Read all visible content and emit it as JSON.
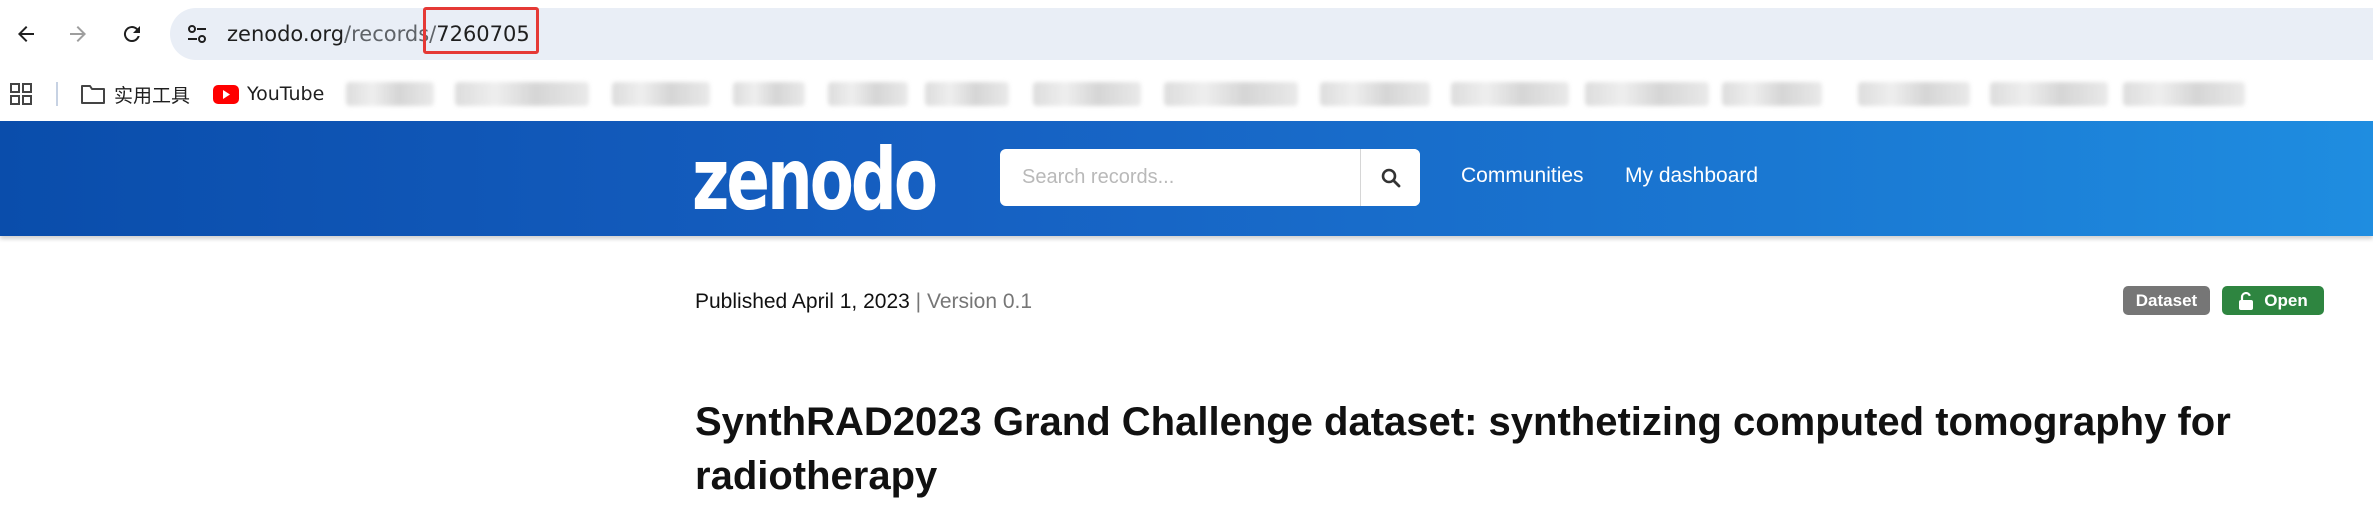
{
  "browser": {
    "url_host": "zenodo.org",
    "url_path": "/records/",
    "url_id": "7260705",
    "icons": {
      "back": "arrow-left-icon",
      "forward": "arrow-right-icon",
      "reload": "reload-icon",
      "site_info": "tune-icon"
    }
  },
  "bookmarks": {
    "apps_icon": "grid-icon",
    "items": [
      {
        "label": "实用工具",
        "icon": "folder-icon"
      },
      {
        "label": "YouTube",
        "icon": "youtube-icon"
      }
    ]
  },
  "header": {
    "logo_text": "zenodo",
    "search_placeholder": "Search records...",
    "nav": [
      "Communities",
      "My dashboard"
    ],
    "colors": {
      "gradient_start": "#0a4dab",
      "gradient_end": "#1f8de0"
    }
  },
  "record": {
    "published": "Published April 1, 2023",
    "separator": "|",
    "version": "Version 0.1",
    "badges": {
      "type": "Dataset",
      "access": "Open"
    },
    "title": "SynthRAD2023 Grand Challenge dataset: synthetizing computed tomography for radiotherapy",
    "colors": {
      "dataset_badge": "#767676",
      "open_badge": "#2e8540"
    }
  }
}
